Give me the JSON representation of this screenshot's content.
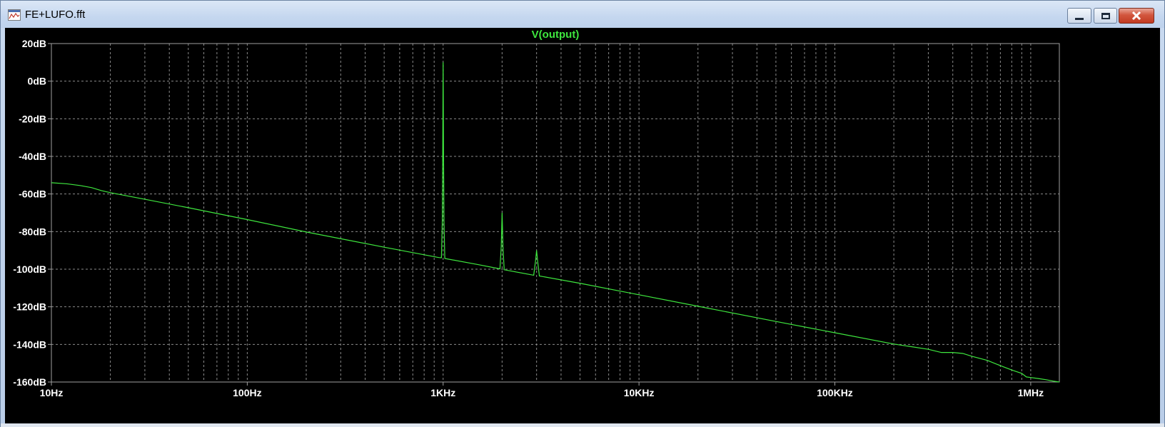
{
  "window": {
    "title": "FE+LUFO.fft",
    "icon": "waveform-document-icon",
    "controls": [
      "minimize-icon",
      "maximize-icon",
      "close-icon"
    ]
  },
  "colors": {
    "plot_background": "#000000",
    "grid": "#8a8a8a",
    "frame": "#a0a0a0",
    "trace": "#3ee63e",
    "title": "#3ee63e",
    "labels": "#ffffff",
    "close_button": "#c8412a"
  },
  "chart_data": {
    "type": "line",
    "title": "V(output)",
    "xlabel": "",
    "ylabel": "",
    "x_scale": "log",
    "grid": true,
    "xlim": [
      10,
      1400000
    ],
    "ylim": [
      -160,
      20
    ],
    "x_ticks": [
      {
        "value": 10,
        "label": "10Hz"
      },
      {
        "value": 100,
        "label": "100Hz"
      },
      {
        "value": 1000,
        "label": "1KHz"
      },
      {
        "value": 10000,
        "label": "10KHz"
      },
      {
        "value": 100000,
        "label": "100KHz"
      },
      {
        "value": 1000000,
        "label": "1MHz"
      }
    ],
    "y_ticks": [
      {
        "value": 20,
        "label": "20dB"
      },
      {
        "value": 0,
        "label": "0dB"
      },
      {
        "value": -20,
        "label": "-20dB"
      },
      {
        "value": -40,
        "label": "-40dB"
      },
      {
        "value": -60,
        "label": "-60dB"
      },
      {
        "value": -80,
        "label": "-80dB"
      },
      {
        "value": -100,
        "label": "-100dB"
      },
      {
        "value": -120,
        "label": "-120dB"
      },
      {
        "value": -140,
        "label": "-140dB"
      },
      {
        "value": -160,
        "label": "-160dB"
      }
    ],
    "series": [
      {
        "points": [
          [
            10,
            -54
          ],
          [
            12,
            -54.6
          ],
          [
            14,
            -55.5
          ],
          [
            16,
            -56.6
          ],
          [
            18,
            -58.2
          ],
          [
            20,
            -59.3
          ],
          [
            30,
            -62.8
          ],
          [
            50,
            -67.3
          ],
          [
            100,
            -73.6
          ],
          [
            200,
            -80.2
          ],
          [
            500,
            -88.3
          ],
          [
            950,
            -93.8
          ],
          [
            980,
            -93.9
          ],
          [
            990,
            -75
          ],
          [
            995,
            -40
          ],
          [
            1000,
            10
          ],
          [
            1005,
            -40
          ],
          [
            1010,
            -75
          ],
          [
            1020,
            -94.3
          ],
          [
            1500,
            -97.5
          ],
          [
            1950,
            -99.8
          ],
          [
            1980,
            -88
          ],
          [
            2000,
            -70
          ],
          [
            2020,
            -88
          ],
          [
            2050,
            -100.3
          ],
          [
            2900,
            -103.2
          ],
          [
            2960,
            -96
          ],
          [
            3000,
            -90
          ],
          [
            3040,
            -96
          ],
          [
            3100,
            -103.6
          ],
          [
            5000,
            -107.5
          ],
          [
            10000,
            -113.6
          ],
          [
            20000,
            -119.7
          ],
          [
            50000,
            -127.8
          ],
          [
            100000,
            -133.8
          ],
          [
            200000,
            -139.8
          ],
          [
            300000,
            -142.6
          ],
          [
            350000,
            -144.3
          ],
          [
            400000,
            -144.3
          ],
          [
            450000,
            -144.8
          ],
          [
            500000,
            -146.3
          ],
          [
            600000,
            -148.5
          ],
          [
            700000,
            -151.3
          ],
          [
            800000,
            -153.6
          ],
          [
            900000,
            -155.4
          ],
          [
            950000,
            -157.3
          ],
          [
            1000000,
            -157.6
          ],
          [
            1100000,
            -158.2
          ],
          [
            1200000,
            -158.8
          ],
          [
            1300000,
            -159.5
          ],
          [
            1400000,
            -160
          ]
        ]
      }
    ]
  }
}
